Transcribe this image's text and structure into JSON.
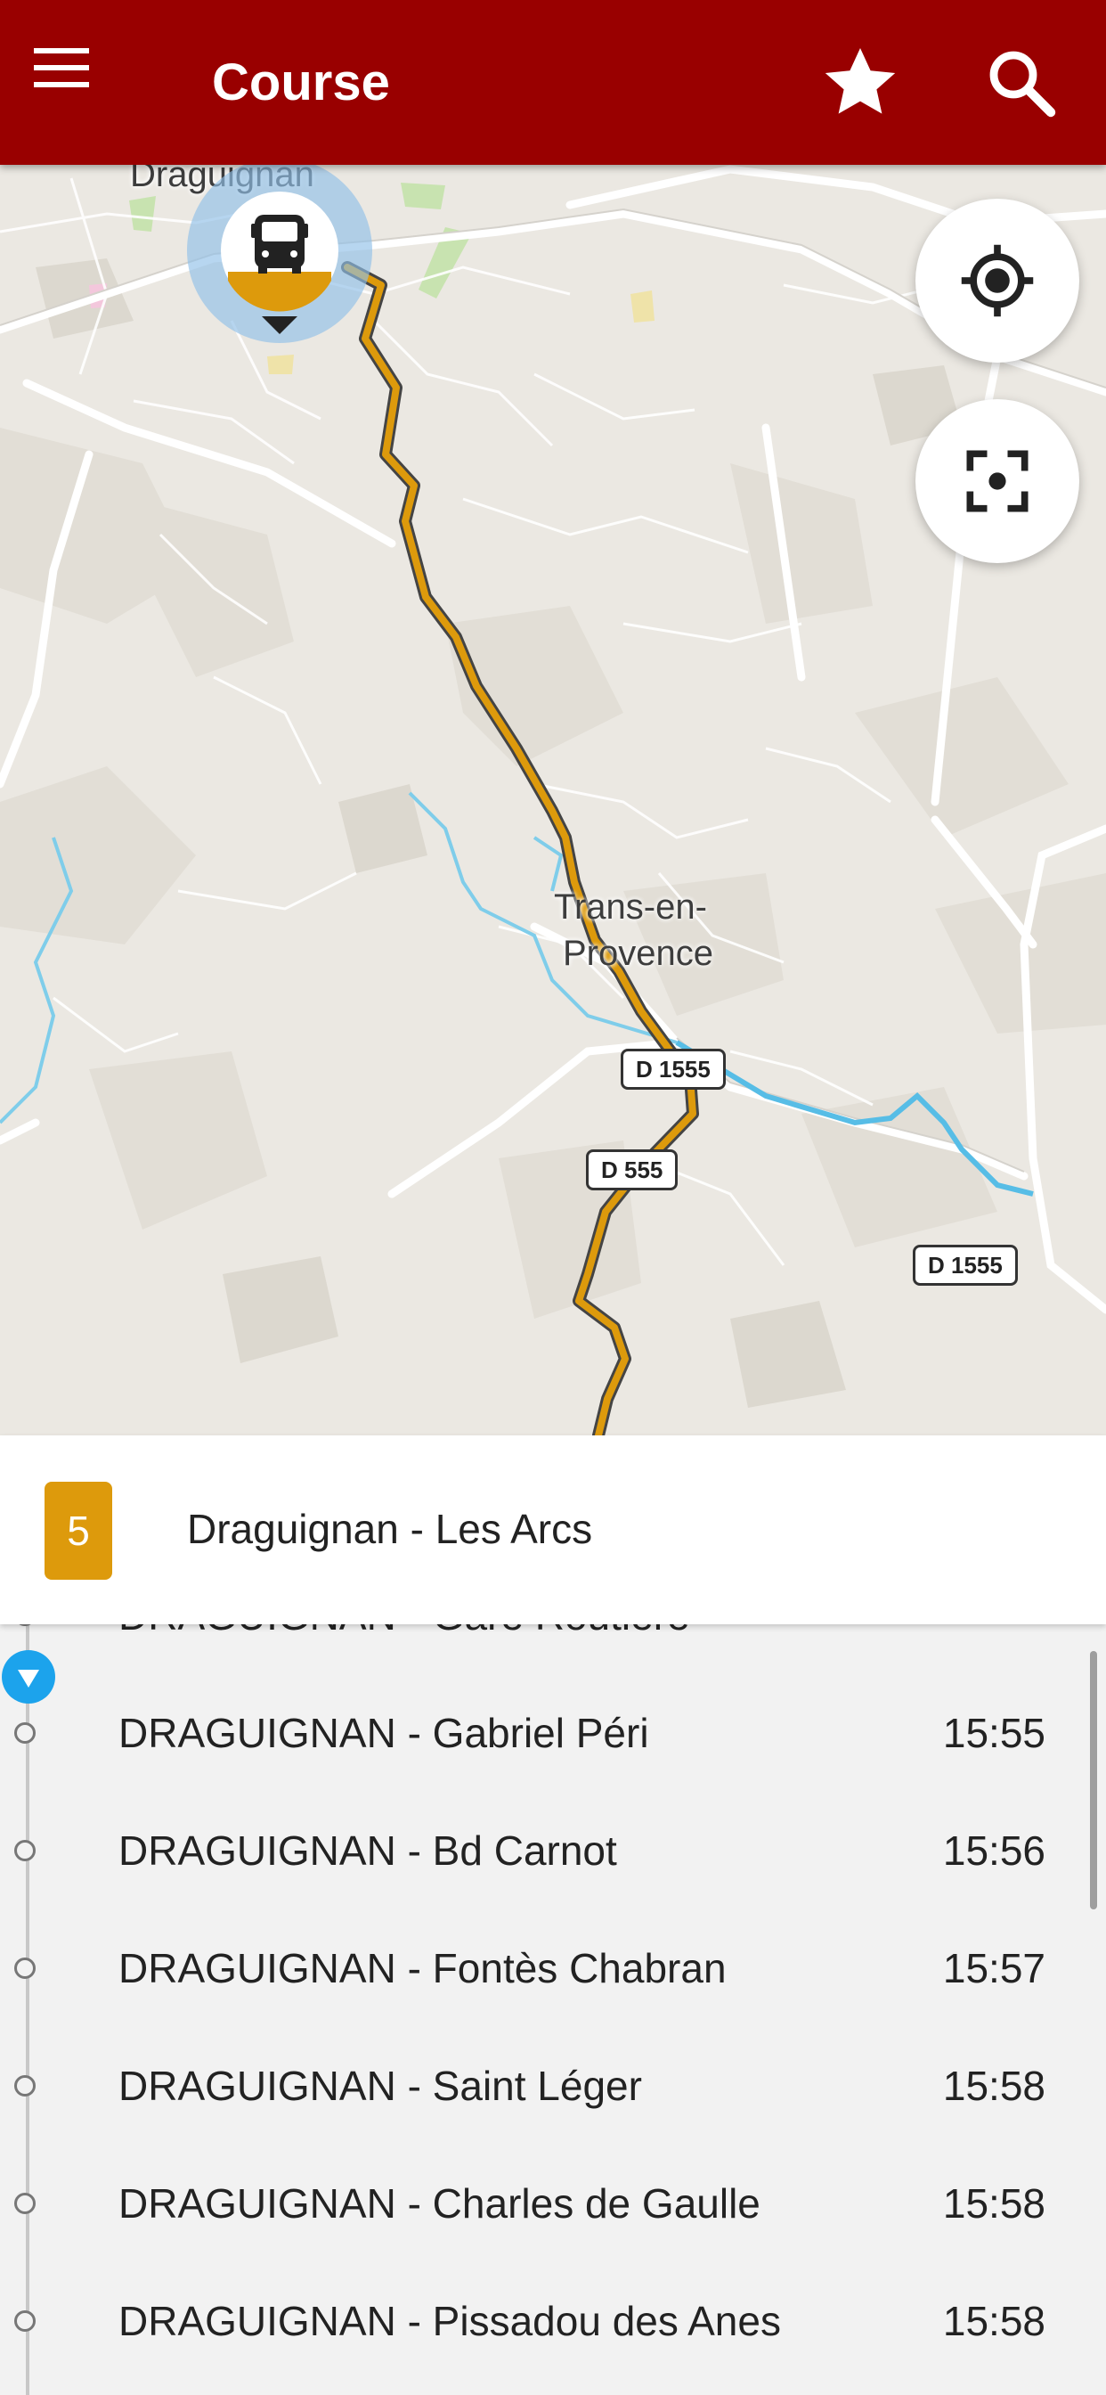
{
  "app_bar": {
    "title": "Course",
    "background_color": "#990000",
    "icons": [
      "menu-icon",
      "star-icon",
      "search-icon"
    ]
  },
  "map": {
    "town_draguignan": "Draguignan",
    "town_trans_line1": "Trans-en-",
    "town_trans_line2": "Provence",
    "road_1": "D 1555",
    "road_2": "D 555",
    "road_3": "D 1555",
    "route_color": "#dd9a0c",
    "controls": [
      "my-location-icon",
      "recenter-icon"
    ]
  },
  "line": {
    "number": "5",
    "name": "Draguignan - Les Arcs",
    "badge_color": "#dd9a0c"
  },
  "stops": [
    {
      "name": "DRAGUIGNAN - Gare Routière",
      "time": "-"
    },
    {
      "name": "DRAGUIGNAN - Gabriel Péri",
      "time": "15:55"
    },
    {
      "name": "DRAGUIGNAN - Bd Carnot",
      "time": "15:56"
    },
    {
      "name": "DRAGUIGNAN - Fontès Chabran",
      "time": "15:57"
    },
    {
      "name": "DRAGUIGNAN - Saint Léger",
      "time": "15:58"
    },
    {
      "name": "DRAGUIGNAN - Charles de Gaulle",
      "time": "15:58"
    },
    {
      "name": "DRAGUIGNAN - Pissadou des Anes",
      "time": "15:58"
    }
  ],
  "current_position_color": "#1ca3ec"
}
